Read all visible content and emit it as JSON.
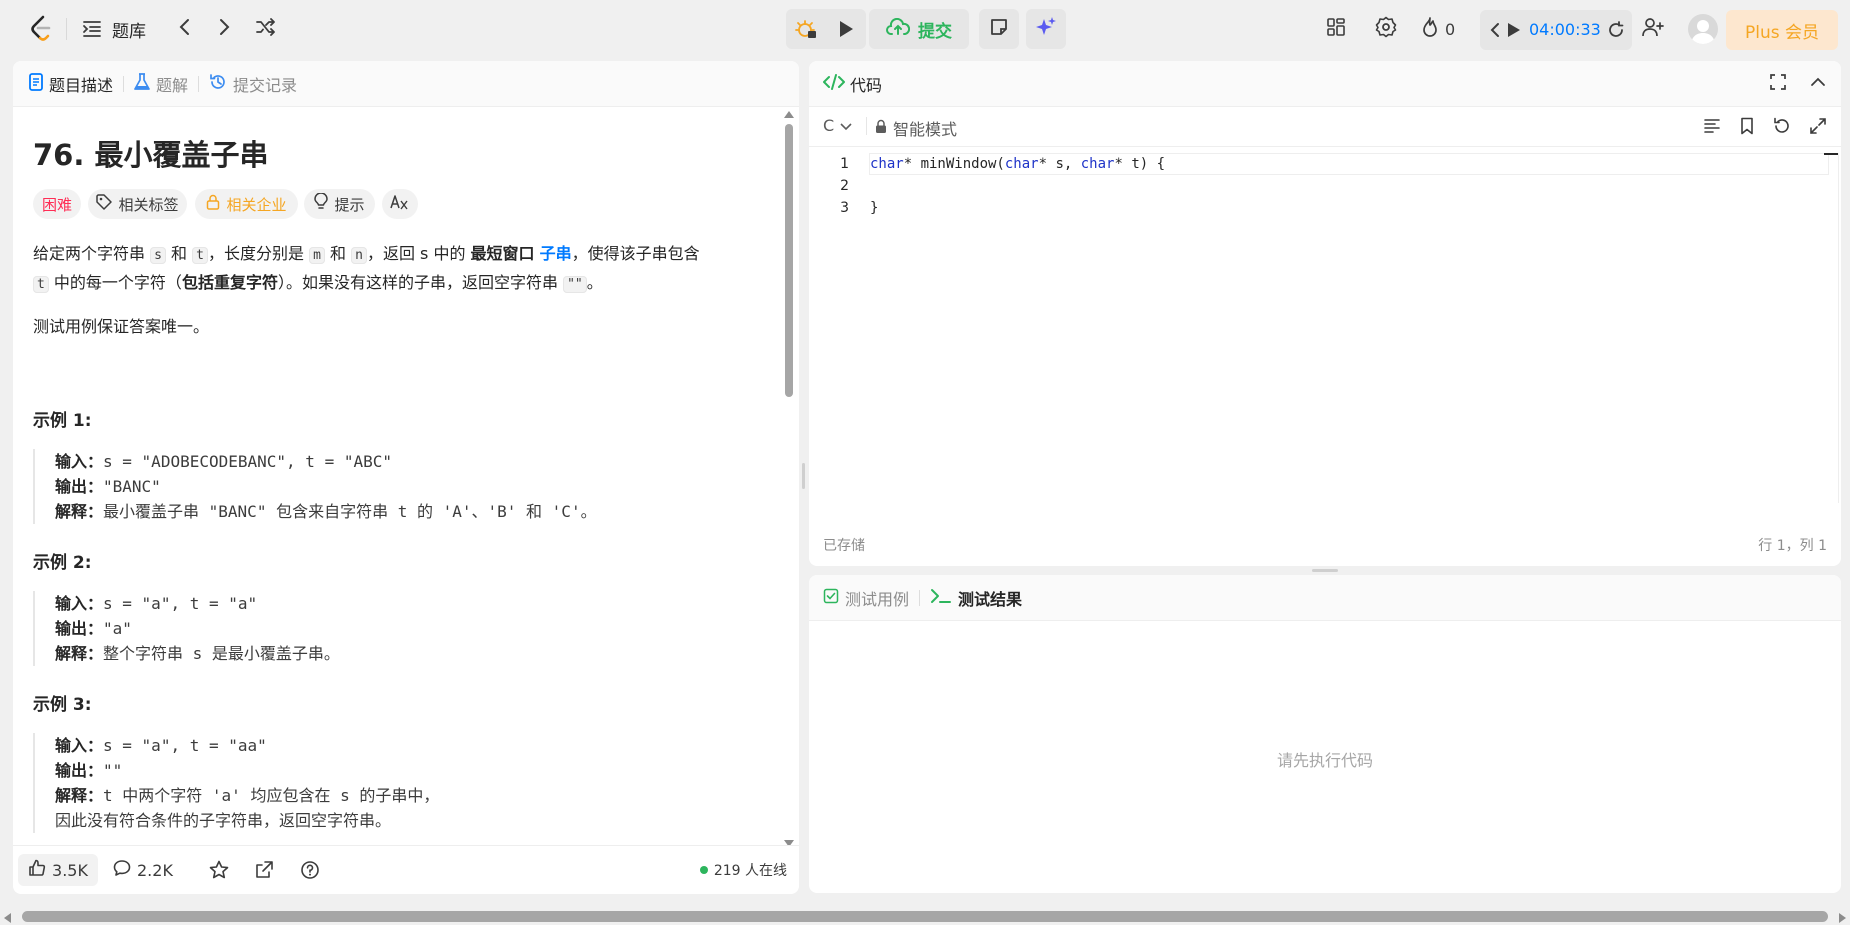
{
  "topbar": {
    "library_label": "题库",
    "submit_label": "提交",
    "streak_count": "0",
    "timer": "04:00:33",
    "plus_label": "Plus 会员"
  },
  "left_tabs": [
    {
      "label": "题目描述"
    },
    {
      "label": "题解"
    },
    {
      "label": "提交记录"
    }
  ],
  "problem": {
    "title": "76. 最小覆盖子串",
    "difficulty": "困难",
    "chips": {
      "tags": "相关标签",
      "companies": "相关企业",
      "hint": "提示"
    },
    "desc_part1": "给定两个字符串",
    "s": "s",
    "and": "和",
    "t": "t",
    "desc_part2": "，长度分别是",
    "m": "m",
    "n": "n",
    "desc_part3": "，返回 s 中的",
    "bold1": "最短窗口",
    "link1": "子串",
    "desc_part4": "，使得该子串包含",
    "desc_part5": "中的每一个字符（",
    "bold2": "包括重复字符",
    "desc_part6": "）。如果没有这样的子串，返回空字符串",
    "empty_str": "\"\"",
    "period": "。",
    "note": "测试用例保证答案唯一。",
    "examples": [
      {
        "title": "示例 1:",
        "input_label": "输入：",
        "input": "s = \"ADOBECODEBANC\", t = \"ABC\"",
        "output_label": "输出：",
        "output": "\"BANC\"",
        "explain_label": "解释：",
        "explain": "最小覆盖子串 \"BANC\" 包含来自字符串 t 的 'A'、'B' 和 'C'。"
      },
      {
        "title": "示例 2:",
        "input_label": "输入：",
        "input": "s = \"a\", t = \"a\"",
        "output_label": "输出：",
        "output": "\"a\"",
        "explain_label": "解释：",
        "explain": "整个字符串 s 是最小覆盖子串。"
      },
      {
        "title": "示例 3:",
        "input_label": "输入：",
        "input": "s = \"a\", t = \"aa\"",
        "output_label": "输出：",
        "output": "\"\"",
        "explain_label": "解释：",
        "explain": "t 中两个字符 'a' 均应包含在 s 的子串中，",
        "explain2": "因此没有符合条件的子字符串，返回空字符串。"
      }
    ]
  },
  "footer": {
    "likes": "3.5K",
    "comments": "2.2K",
    "online": "219 人在线"
  },
  "editor": {
    "tab_label": "代码",
    "language": "C",
    "mode_label": "智能模式",
    "line_numbers": [
      "1",
      "2",
      "3"
    ],
    "code": {
      "kw1": "char",
      "p1": "* minWindow(",
      "kw2": "char",
      "p2": "* s, ",
      "kw3": "char",
      "p3": "* t) {",
      "line3": "}"
    },
    "saved_label": "已存储",
    "cursor_pos": "行 1，列 1"
  },
  "test": {
    "tab_cases": "测试用例",
    "tab_result": "测试结果",
    "placeholder": "请先执行代码"
  },
  "colors": {
    "accent_blue": "#007aff",
    "submit_green": "#2db55d",
    "hard_red": "#ff2d55",
    "company_orange": "#f5a623"
  }
}
